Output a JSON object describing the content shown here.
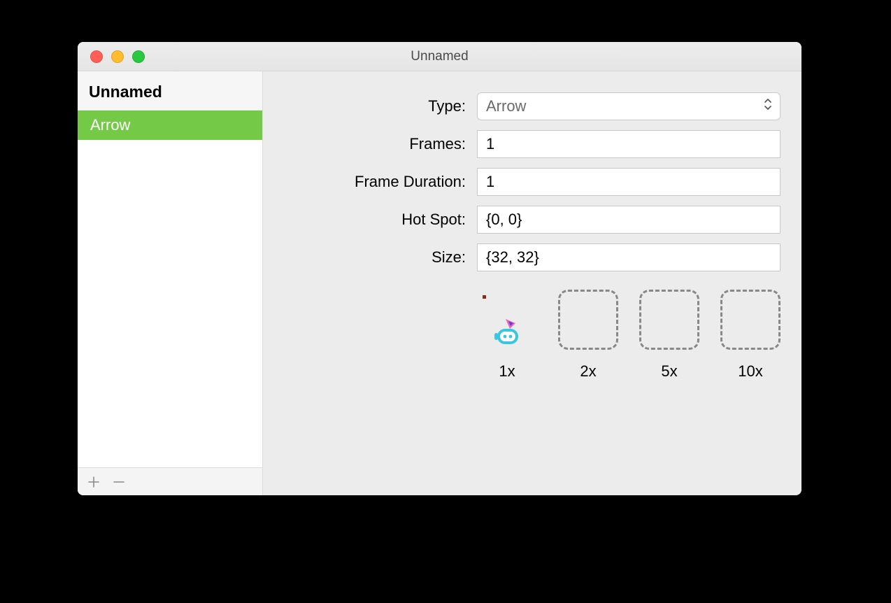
{
  "window": {
    "title": "Unnamed"
  },
  "sidebar": {
    "header": "Unnamed",
    "items": [
      "Arrow"
    ]
  },
  "form": {
    "type": {
      "label": "Type:",
      "value": "Arrow"
    },
    "frames": {
      "label": "Frames:",
      "value": "1"
    },
    "frame_duration": {
      "label": "Frame Duration:",
      "value": "1"
    },
    "hot_spot": {
      "label": "Hot Spot:",
      "value": "{0, 0}"
    },
    "size": {
      "label": "Size:",
      "value": "{32, 32}"
    }
  },
  "previews": {
    "labels": [
      "1x",
      "2x",
      "5x",
      "10x"
    ]
  }
}
